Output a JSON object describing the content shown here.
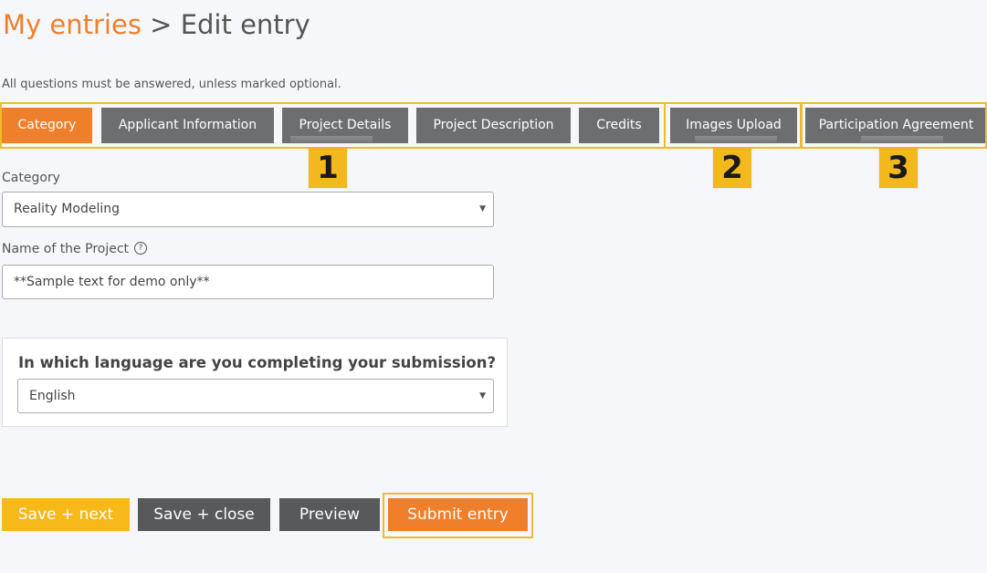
{
  "header": {
    "breadcrumb_link": "My entries",
    "separator": ">",
    "current": "Edit entry"
  },
  "instructions": "All questions must be answered, unless marked optional.",
  "tabs": [
    {
      "label": "Category",
      "active": true
    },
    {
      "label": "Applicant Information",
      "active": false
    },
    {
      "label": "Project Details",
      "active": false
    },
    {
      "label": "Project Description",
      "active": false
    },
    {
      "label": "Credits",
      "active": false
    },
    {
      "label": "Images Upload",
      "active": false
    },
    {
      "label": "Participation Agreement",
      "active": false
    }
  ],
  "badges": [
    "1",
    "2",
    "3"
  ],
  "form": {
    "category_label": "Category",
    "category_value": "Reality Modeling",
    "project_name_label": "Name of the Project",
    "project_name_value": "**Sample text for demo only**",
    "language_question": "In which language are you completing your submission?",
    "language_value": "English"
  },
  "buttons": {
    "save_next": "Save + next",
    "save_close": "Save + close",
    "preview": "Preview",
    "submit": "Submit entry"
  },
  "colors": {
    "accent": "#f07f2b",
    "tab_gray": "#6d6e70",
    "highlight": "#f0bb2a",
    "save_next": "#f7b819"
  }
}
